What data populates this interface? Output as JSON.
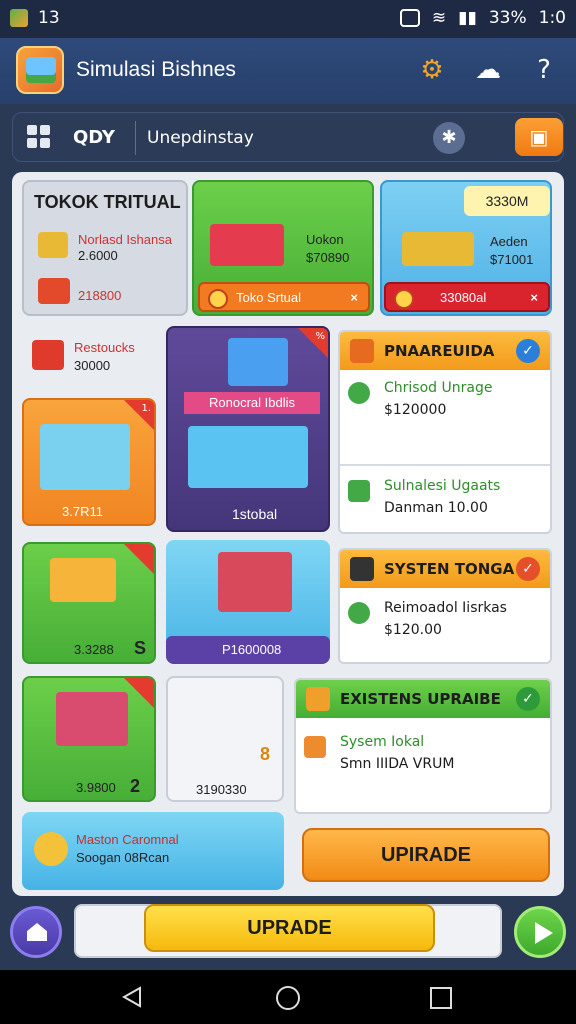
{
  "status_bar": {
    "left_text": "13",
    "battery": "33%",
    "time": "1:0"
  },
  "header": {
    "title": "Simulasi Bishnes"
  },
  "toolbar": {
    "qty_label": "QDY",
    "text": "Unepdinstay"
  },
  "cards": {
    "toko_virtual": {
      "title": "TOKOK TRITUAL",
      "item1_label": "Norlasd Ishansa",
      "item1_value": "2.6000",
      "item2_value": "218800"
    },
    "ukon": {
      "label": "Uokon",
      "value": "$70890",
      "bar_label": "Toko Srtual",
      "bar_close": "×"
    },
    "aeden": {
      "tag": "3330M",
      "label": "Aeden",
      "value": "$71001",
      "bar_label": "33080al",
      "bar_close": "×"
    },
    "restocks": {
      "label": "Restoucks",
      "value": "30000"
    },
    "shop_orange": {
      "value": "3.7R11",
      "tag": "1."
    },
    "purple": {
      "banner": "Ronocral Ibdlis",
      "tag1": "%",
      "tag2": "%",
      "label": "1stobal"
    },
    "green_printer": {
      "value": "3.3288",
      "badge": "S"
    },
    "blue_machine": {
      "bar_label": "P1600008"
    },
    "green_shop2": {
      "value": "3.9800",
      "badge": "2"
    },
    "white_card": {
      "badge": "8",
      "value": "3190330"
    },
    "maston": {
      "line1": "Maston Caromnal",
      "line2": "Soogan 08Rcan"
    }
  },
  "info_panels": {
    "panel1": {
      "title": "PNAAREUIDA",
      "row1_title": "Chrisod Unrage",
      "row1_value": "$120000",
      "row2_title": "Sulnalesi Ugaats",
      "row2_value": "Danman 10.00"
    },
    "panel2": {
      "title": "SYSTEN TONGA",
      "row1_title": "Reimoadol Iisrkas",
      "row1_value": "$120.00"
    },
    "panel3": {
      "title": "EXISTENS UPRAIBE",
      "row1_title": "Sysem Iokal",
      "row1_value": "Smn IIIDA VRUM"
    }
  },
  "buttons": {
    "upgrade_inner": "UPIRADE",
    "upgrade_bottom": "UPRADE"
  },
  "progress": {
    "fill_percent": 68
  }
}
